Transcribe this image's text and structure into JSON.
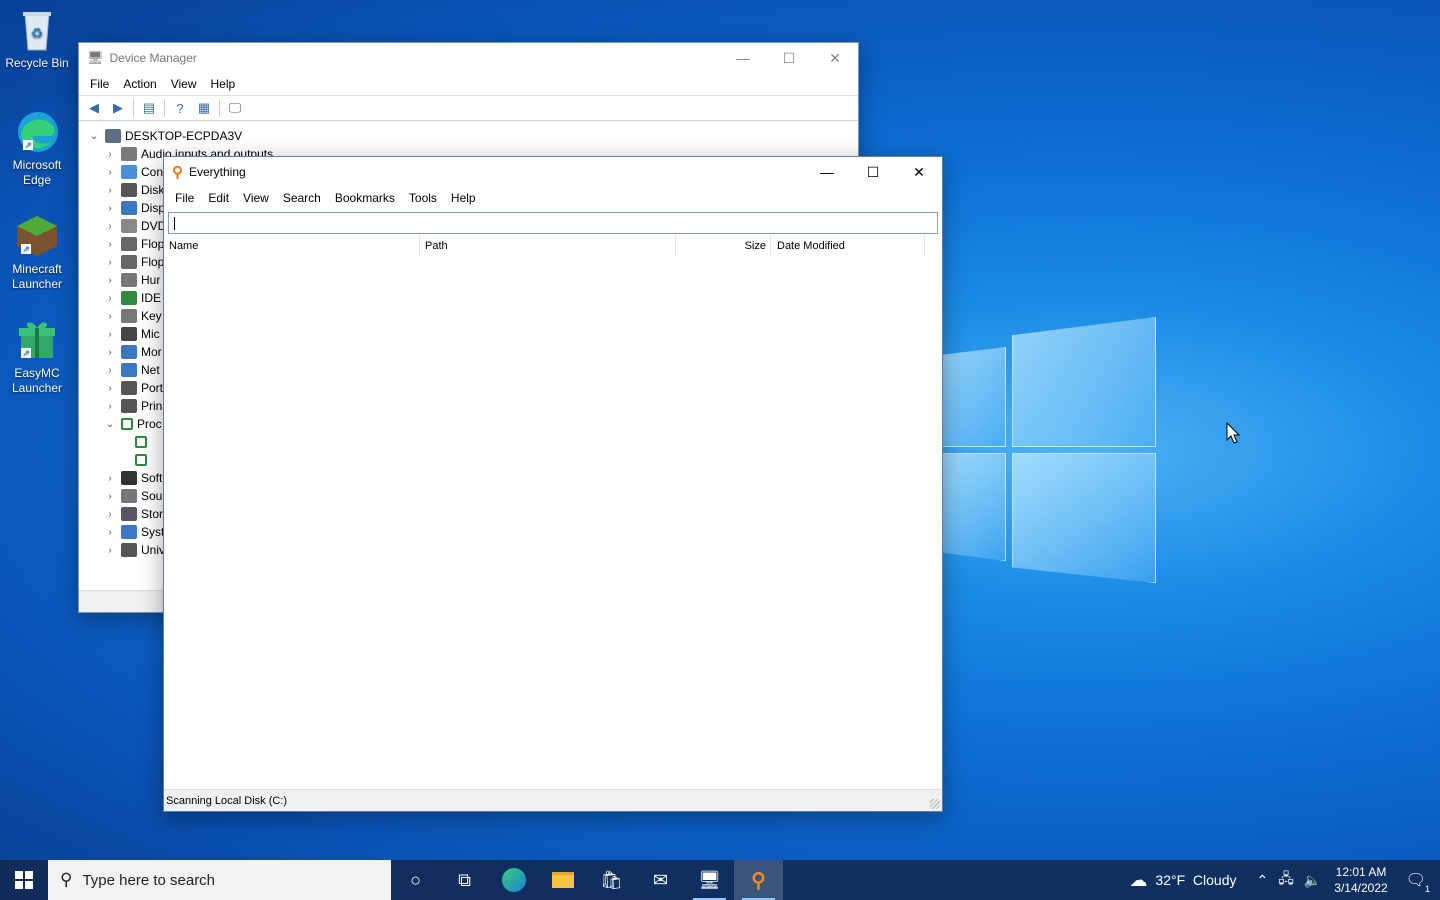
{
  "desktop": {
    "icons": [
      {
        "label": "Recycle Bin"
      },
      {
        "label": "Microsoft Edge"
      },
      {
        "label": "Minecraft Launcher"
      },
      {
        "label": "EasyMC Launcher"
      }
    ]
  },
  "device_manager": {
    "title": "Device Manager",
    "menu": [
      "File",
      "Action",
      "View",
      "Help"
    ],
    "root": "DESKTOP-ECPDA3V",
    "items": [
      "Audio inputs and outputs",
      "Con",
      "Disk",
      "Disp",
      "DVD",
      "Flop",
      "Flop",
      "Hur",
      "IDE",
      "Key",
      "Mic",
      "Mor",
      "Net",
      "Port",
      "Prin",
      "Proc",
      "",
      "",
      "Soft",
      "Sou",
      "Stor",
      "Syst",
      "Univ"
    ]
  },
  "everything": {
    "title": "Everything",
    "menu": [
      "File",
      "Edit",
      "View",
      "Search",
      "Bookmarks",
      "Tools",
      "Help"
    ],
    "search_value": "",
    "columns": {
      "name": "Name",
      "path": "Path",
      "size": "Size",
      "date": "Date Modified"
    },
    "status": "Scanning Local Disk (C:)"
  },
  "taskbar": {
    "search_placeholder": "Type here to search",
    "weather": "32°F  Cloudy",
    "time": "12:01 AM",
    "date": "3/14/2022",
    "notifications": "1"
  },
  "colors": {
    "accent": "#0078d7",
    "taskbar": "#10284f"
  }
}
